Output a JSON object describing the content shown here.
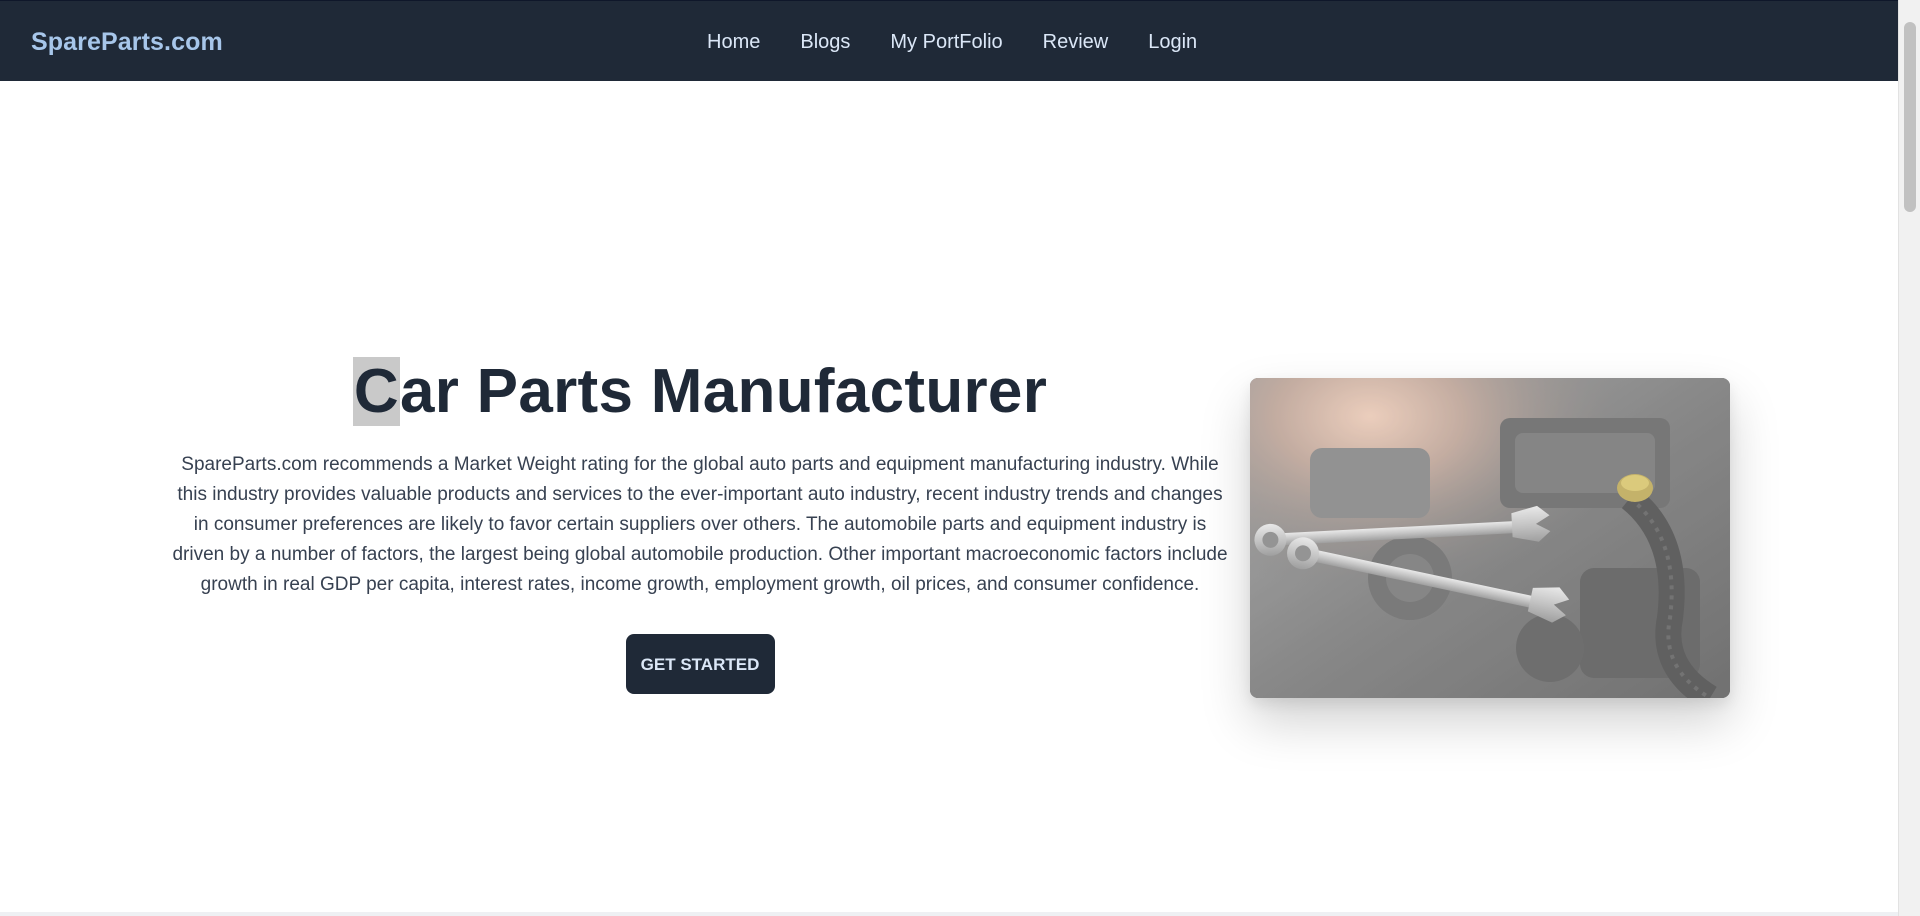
{
  "brand": {
    "name": "SpareParts.com"
  },
  "nav": {
    "items": [
      {
        "label": "Home"
      },
      {
        "label": "Blogs"
      },
      {
        "label": "My PortFolio"
      },
      {
        "label": "Review"
      },
      {
        "label": "Login"
      }
    ]
  },
  "hero": {
    "title_first": "C",
    "title_rest": "ar Parts Manufacturer",
    "paragraph": "SpareParts.com recommends a Market Weight rating for the global auto parts and equipment manufacturing industry. While this industry provides valuable products and services to the ever-important auto industry, recent industry trends and changes in consumer preferences are likely to favor certain suppliers over others. The automobile parts and equipment industry is driven by a number of factors, the largest being global automobile production. Other important macroeconomic factors include growth in real GDP per capita, interest rates, income growth, employment growth, oil prices, and consumer confidence.",
    "cta_label": "GET STARTED",
    "image": "engine-bay-with-wrenches"
  },
  "colors": {
    "navbar_bg": "#1f2937",
    "brand": "#a7c6ea",
    "nav_text": "#dbe7f7",
    "heading": "#1f2937",
    "body_text": "#374151"
  }
}
